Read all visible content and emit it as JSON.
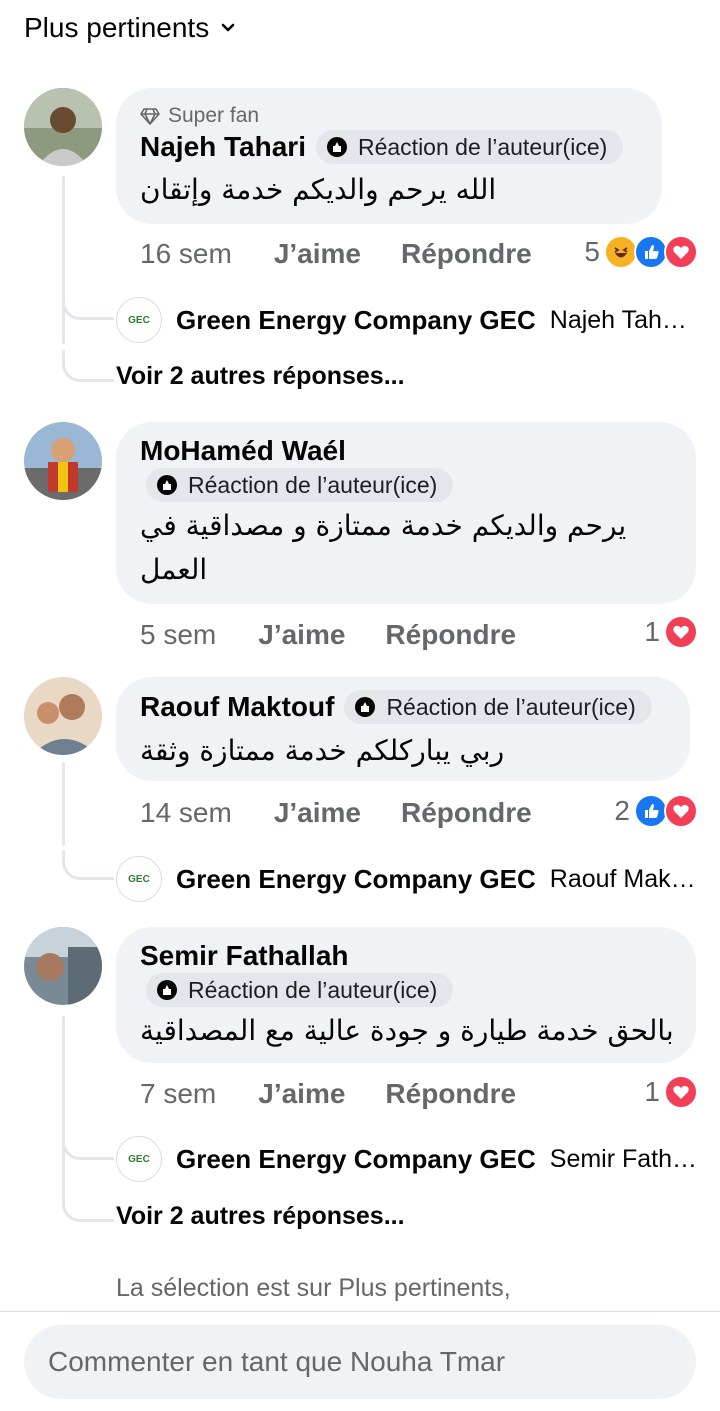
{
  "sort": {
    "label": "Plus pertinents"
  },
  "comments": [
    {
      "badge": "Super fan",
      "author": "Najeh Tahari",
      "author_tag": "Réaction de l’auteur(ice)",
      "text": "الله يرحم والديكم خدمة وإتقان",
      "time": "16 sem",
      "like_label": "J’aime",
      "reply_label": "Répondre",
      "reaction_count": "5",
      "reactions": [
        "haha",
        "like",
        "love"
      ],
      "reply": {
        "author": "Green Energy Company GEC",
        "preview": "Najeh Taha…"
      },
      "more_replies": "Voir 2 autres réponses..."
    },
    {
      "author": "MoHaméd Waél",
      "author_tag": "Réaction de l’auteur(ice)",
      "text": "يرحم والديكم خدمة ممتازة و مصداقية في العمل",
      "time": "5 sem",
      "like_label": "J’aime",
      "reply_label": "Répondre",
      "reaction_count": "1",
      "reactions": [
        "love"
      ]
    },
    {
      "author": "Raouf Maktouf",
      "author_tag": "Réaction de l’auteur(ice)",
      "text": "ربي يباركلكم خدمة ممتازة وثقة",
      "time": "14 sem",
      "like_label": "J’aime",
      "reply_label": "Répondre",
      "reaction_count": "2",
      "reactions": [
        "like",
        "love"
      ],
      "reply": {
        "author": "Green Energy Company GEC",
        "preview": "Raouf Makt…"
      }
    },
    {
      "author": "Semir Fathallah",
      "author_tag": "Réaction de l’auteur(ice)",
      "text": "بالحق خدمة طيارة و جودة عالية مع المصداقية",
      "time": "7 sem",
      "like_label": "J’aime",
      "reply_label": "Répondre",
      "reaction_count": "1",
      "reactions": [
        "love"
      ],
      "reply": {
        "author": "Green Energy Company GEC",
        "preview": "Semir Fath…"
      },
      "more_replies": "Voir 2 autres réponses..."
    }
  ],
  "gec_logo_text": "GEC",
  "selection_note": "La sélection est sur Plus pertinents,",
  "composer": {
    "placeholder": "Commenter en tant que Nouha Tmar"
  },
  "colors": {
    "love": "#f33e58",
    "like": "#1877f2",
    "haha": "#f7b125",
    "bubble": "#f0f2f5",
    "muted": "#65676b"
  }
}
